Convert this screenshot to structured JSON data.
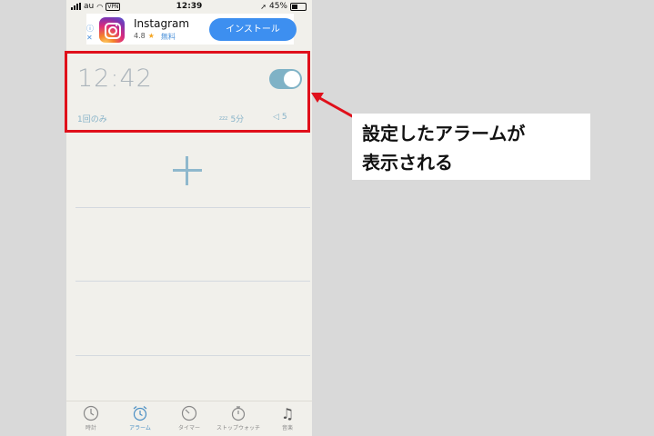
{
  "status_bar": {
    "carrier": "au",
    "vpn": "VPN",
    "time": "12:39",
    "battery": "45%"
  },
  "ad": {
    "info": "ⓘ",
    "close": "✕",
    "app_name": "Instagram",
    "rating": "4.8",
    "star": "★",
    "price": "無料",
    "install_label": "インストール"
  },
  "alarm": {
    "time": "12:42",
    "enabled": true,
    "repeat": "1回のみ",
    "snooze_icon": "zzz",
    "snooze": "5分",
    "volume_icon": "speaker-icon",
    "volume": "5"
  },
  "add_button": {
    "icon": "plus-icon"
  },
  "tabs": [
    {
      "label": "時計",
      "icon": "clock-icon",
      "active": false
    },
    {
      "label": "アラーム",
      "icon": "alarm-clock-icon",
      "active": true
    },
    {
      "label": "タイマー",
      "icon": "timer-icon",
      "active": false
    },
    {
      "label": "ストップウォッチ",
      "icon": "stopwatch-icon",
      "active": false
    },
    {
      "label": "音楽",
      "icon": "music-note-icon",
      "active": false
    }
  ],
  "annotation": {
    "line1": "設定したアラームが",
    "line2": "表示される",
    "color": "#e0101b"
  },
  "colors": {
    "accent": "#7fb2c6",
    "install_button": "#3d8ff0",
    "background": "#f1f0eb"
  }
}
